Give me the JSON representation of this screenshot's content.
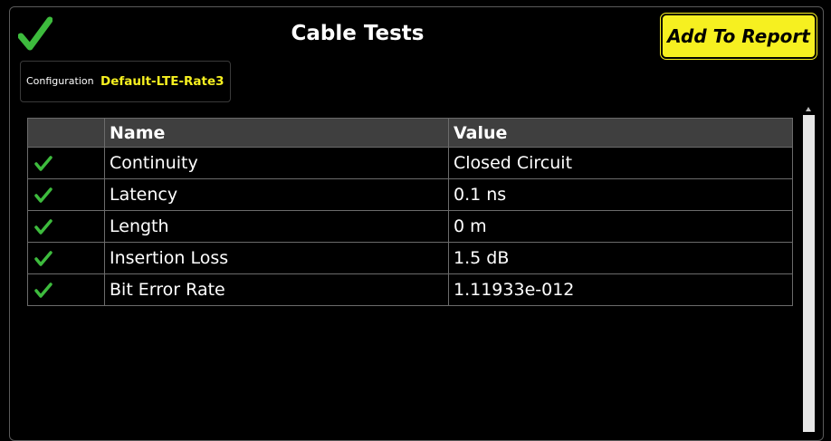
{
  "header": {
    "title": "Cable Tests",
    "add_to_report_label": "Add To Report",
    "status_icon": "check-icon",
    "status_color": "#3dbb3d"
  },
  "configuration": {
    "label": "Configuration",
    "value": "Default-LTE-Rate3"
  },
  "table": {
    "columns": [
      "",
      "Name",
      "Value"
    ],
    "rows": [
      {
        "status": "pass",
        "name": "Continuity",
        "value": "Closed Circuit"
      },
      {
        "status": "pass",
        "name": "Latency",
        "value": "0.1 ns"
      },
      {
        "status": "pass",
        "name": "Length",
        "value": "0 m"
      },
      {
        "status": "pass",
        "name": "Insertion Loss",
        "value": "1.5 dB"
      },
      {
        "status": "pass",
        "name": "Bit Error Rate",
        "value": "1.11933e-012"
      }
    ]
  },
  "colors": {
    "accent": "#f6f020",
    "pass": "#3dbb3d",
    "header_row": "#3f3f3f"
  }
}
